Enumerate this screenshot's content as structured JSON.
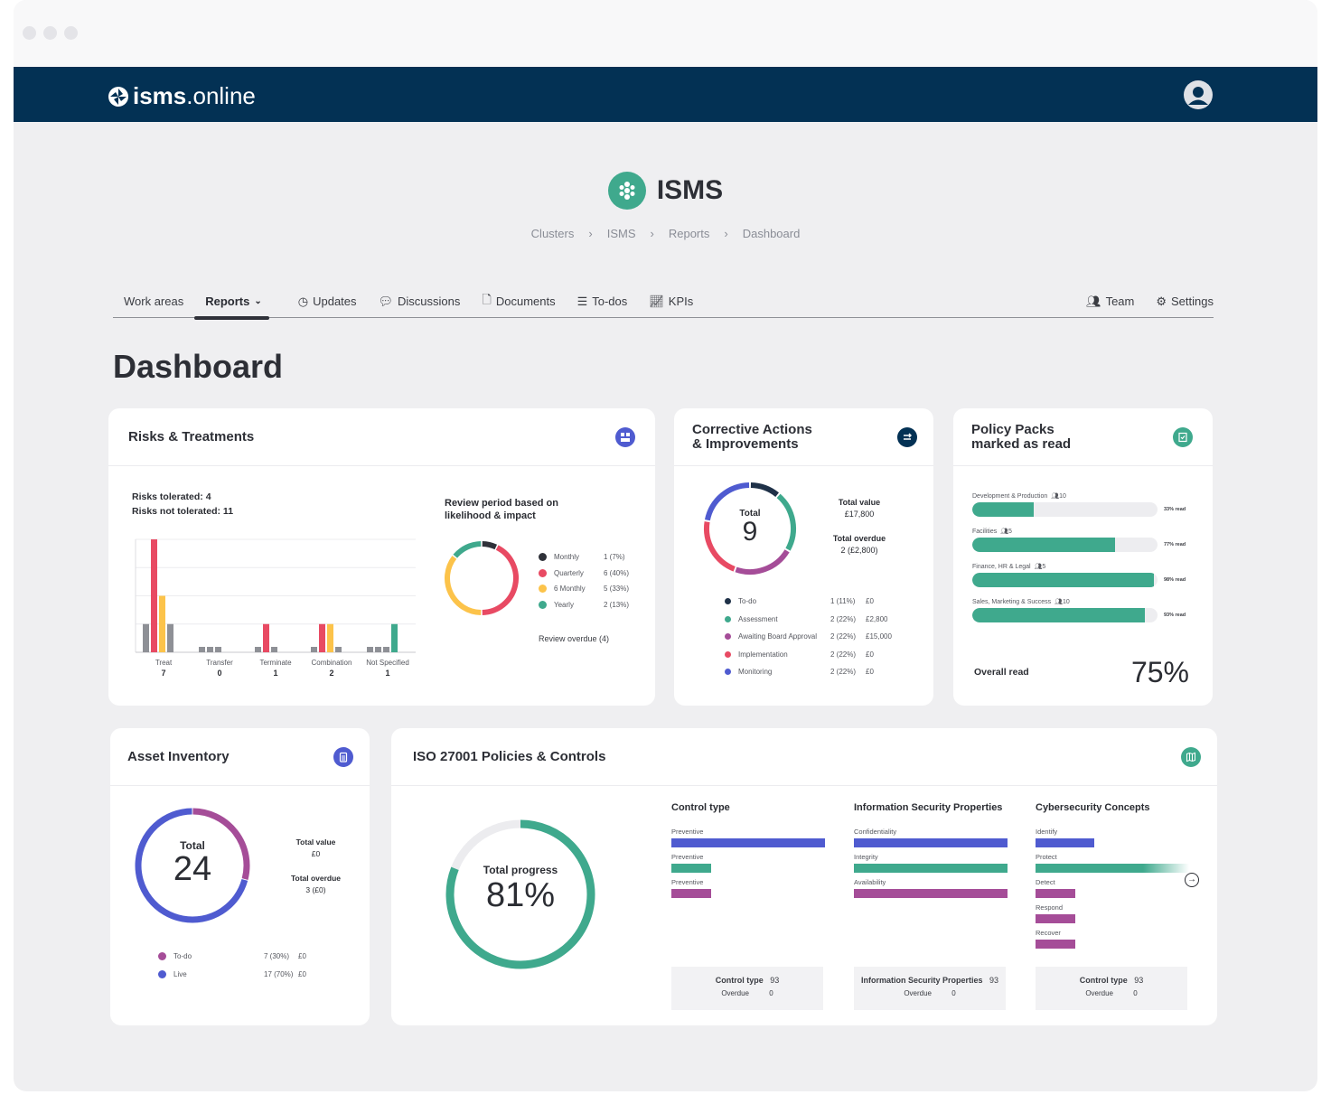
{
  "app": {
    "brand_bold": "isms",
    "brand_light": ".online"
  },
  "workspace": {
    "title": "ISMS",
    "breadcrumb": [
      "Clusters",
      "ISMS",
      "Reports",
      "Dashboard"
    ]
  },
  "nav": {
    "items": [
      {
        "label": "Work areas",
        "icon": ""
      },
      {
        "label": "Reports",
        "icon": "chevron-down-icon",
        "active": true
      },
      {
        "label": "Updates",
        "icon": "clock-icon"
      },
      {
        "label": "Discussions",
        "icon": "chat-icon"
      },
      {
        "label": "Documents",
        "icon": "document-icon"
      },
      {
        "label": "To-dos",
        "icon": "list-icon"
      },
      {
        "label": "KPIs",
        "icon": "chart-line-icon"
      }
    ],
    "right": [
      {
        "label": "Team",
        "icon": "team-icon"
      },
      {
        "label": "Settings",
        "icon": "gear-icon"
      }
    ]
  },
  "page": {
    "title": "Dashboard"
  },
  "colors": {
    "navy": "#033154",
    "green": "#3fa98d",
    "red": "#e84a63",
    "yellow": "#fcc34a",
    "purple": "#a54d98",
    "blue": "#4f5bd0",
    "dark": "#1f3148",
    "grey": "#8e9096"
  },
  "risks": {
    "title": "Risks & Treatments",
    "tolerated": "Risks tolerated: 4",
    "not_tolerated": "Risks not tolerated: 11",
    "chart_data": {
      "type": "bar",
      "categories": [
        "Treat",
        "Transfer",
        "Terminate",
        "Combination",
        "Not Specified"
      ],
      "totals": [
        7,
        0,
        1,
        2,
        1
      ],
      "series": [
        {
          "name": "grey-a",
          "color": "#8e9096",
          "values": [
            1,
            0,
            0,
            0,
            0
          ]
        },
        {
          "name": "red",
          "color": "#e84a63",
          "values": [
            4,
            0,
            1,
            1,
            0
          ]
        },
        {
          "name": "yellow",
          "color": "#fcc34a",
          "values": [
            2,
            0,
            0,
            1,
            0
          ]
        },
        {
          "name": "grey-b",
          "color": "#8e9096",
          "values": [
            1,
            0,
            0,
            0,
            0
          ]
        },
        {
          "name": "green",
          "color": "#3fa98d",
          "values": [
            0,
            0,
            0,
            0,
            1
          ]
        }
      ],
      "ylim": [
        0,
        4
      ],
      "grid": true
    },
    "review": {
      "title_1": "Review period based on",
      "title_2": "likelihood & impact",
      "overdue": "Review overdue (4)",
      "chart_data": {
        "type": "pie",
        "slices": [
          {
            "label": "Monthly",
            "value": 1,
            "text": "1 (7%)",
            "color": "#2f3139"
          },
          {
            "label": "Quarterly",
            "value": 6,
            "text": "6 (40%)",
            "color": "#e84a63"
          },
          {
            "label": "6 Monthly",
            "value": 5,
            "text": "5 (33%)",
            "color": "#fcc34a"
          },
          {
            "label": "Yearly",
            "value": 2,
            "text": "2 (13%)",
            "color": "#3fa98d"
          }
        ]
      }
    }
  },
  "corrective": {
    "title_1": "Corrective Actions",
    "title_2": "& Improvements",
    "total_label": "Total",
    "total": "9",
    "value_label": "Total value",
    "value": "£17,800",
    "overdue_label": "Total overdue",
    "overdue": "2 (£2,800)",
    "chart_data": {
      "type": "pie",
      "slices": [
        {
          "label": "To-do",
          "value": 1,
          "pct": "1 (11%)",
          "amount": "£0",
          "color": "#1f3148"
        },
        {
          "label": "Assessment",
          "value": 2,
          "pct": "2 (22%)",
          "amount": "£2,800",
          "color": "#3fa98d"
        },
        {
          "label": "Awaiting Board Approval",
          "value": 2,
          "pct": "2 (22%)",
          "amount": "£15,000",
          "color": "#a54d98"
        },
        {
          "label": "Implementation",
          "value": 2,
          "pct": "2 (22%)",
          "amount": "£0",
          "color": "#e84a63"
        },
        {
          "label": "Monitoring",
          "value": 2,
          "pct": "2 (22%)",
          "amount": "£0",
          "color": "#4f5bd0"
        }
      ]
    }
  },
  "policy": {
    "title_1": "Policy Packs",
    "title_2": "marked as read",
    "overall_label": "Overall read",
    "overall": "75%",
    "packs": [
      {
        "name": "Development & Production",
        "members": "10",
        "read": 33,
        "read_label": "33% read"
      },
      {
        "name": "Facilities",
        "members": "5",
        "read": 77,
        "read_label": "77% read"
      },
      {
        "name": "Finance, HR & Legal",
        "members": "5",
        "read": 98,
        "read_label": "98% read"
      },
      {
        "name": "Sales, Marketing & Success",
        "members": "10",
        "read": 93,
        "read_label": "93% read"
      }
    ]
  },
  "assets": {
    "title": "Asset Inventory",
    "total_label": "Total",
    "total": "24",
    "value_label": "Total value",
    "value": "£0",
    "overdue_label": "Total overdue",
    "overdue": "3 (£0)",
    "chart_data": {
      "type": "pie",
      "slices": [
        {
          "label": "To-do",
          "value": 7,
          "pct": "7 (30%)",
          "amount": "£0",
          "color": "#a54d98"
        },
        {
          "label": "Live",
          "value": 17,
          "pct": "17 (70%)",
          "amount": "£0",
          "color": "#4f5bd0"
        }
      ]
    }
  },
  "iso": {
    "title": "ISO 27001 Policies & Controls",
    "progress_label": "Total progress",
    "progress": "81%",
    "progress_value": 81,
    "groups": [
      {
        "title": "Control type",
        "bars": [
          {
            "label": "Preventive",
            "value": 100,
            "color": "#4f5bd0"
          },
          {
            "label": "Preventive",
            "value": 26,
            "color": "#3fa98d"
          },
          {
            "label": "Preventive",
            "value": 26,
            "color": "#a54d98"
          }
        ],
        "summary_label": "Control type",
        "summary_value": "93",
        "overdue_label": "Overdue",
        "overdue_value": "0"
      },
      {
        "title": "Information Security Properties",
        "bars": [
          {
            "label": "Confidentiality",
            "value": 100,
            "color": "#4f5bd0"
          },
          {
            "label": "Integrity",
            "value": 100,
            "color": "#3fa98d"
          },
          {
            "label": "Availability",
            "value": 100,
            "color": "#a54d98"
          }
        ],
        "summary_label": "Information Security Properties",
        "summary_value": "93",
        "overdue_label": "Overdue",
        "overdue_value": "0"
      },
      {
        "title": "Cybersecurity Concepts",
        "bars": [
          {
            "label": "Identify",
            "value": 38,
            "color": "#4f5bd0"
          },
          {
            "label": "Protect",
            "value": 100,
            "color": "#3fa98d"
          },
          {
            "label": "Detect",
            "value": 26,
            "color": "#a54d98"
          },
          {
            "label": "Respond",
            "value": 26,
            "color": "#a54d98"
          },
          {
            "label": "Recover",
            "value": 26,
            "color": "#a54d98"
          }
        ],
        "summary_label": "Control type",
        "summary_value": "93",
        "overdue_label": "Overdue",
        "overdue_value": "0"
      }
    ]
  }
}
